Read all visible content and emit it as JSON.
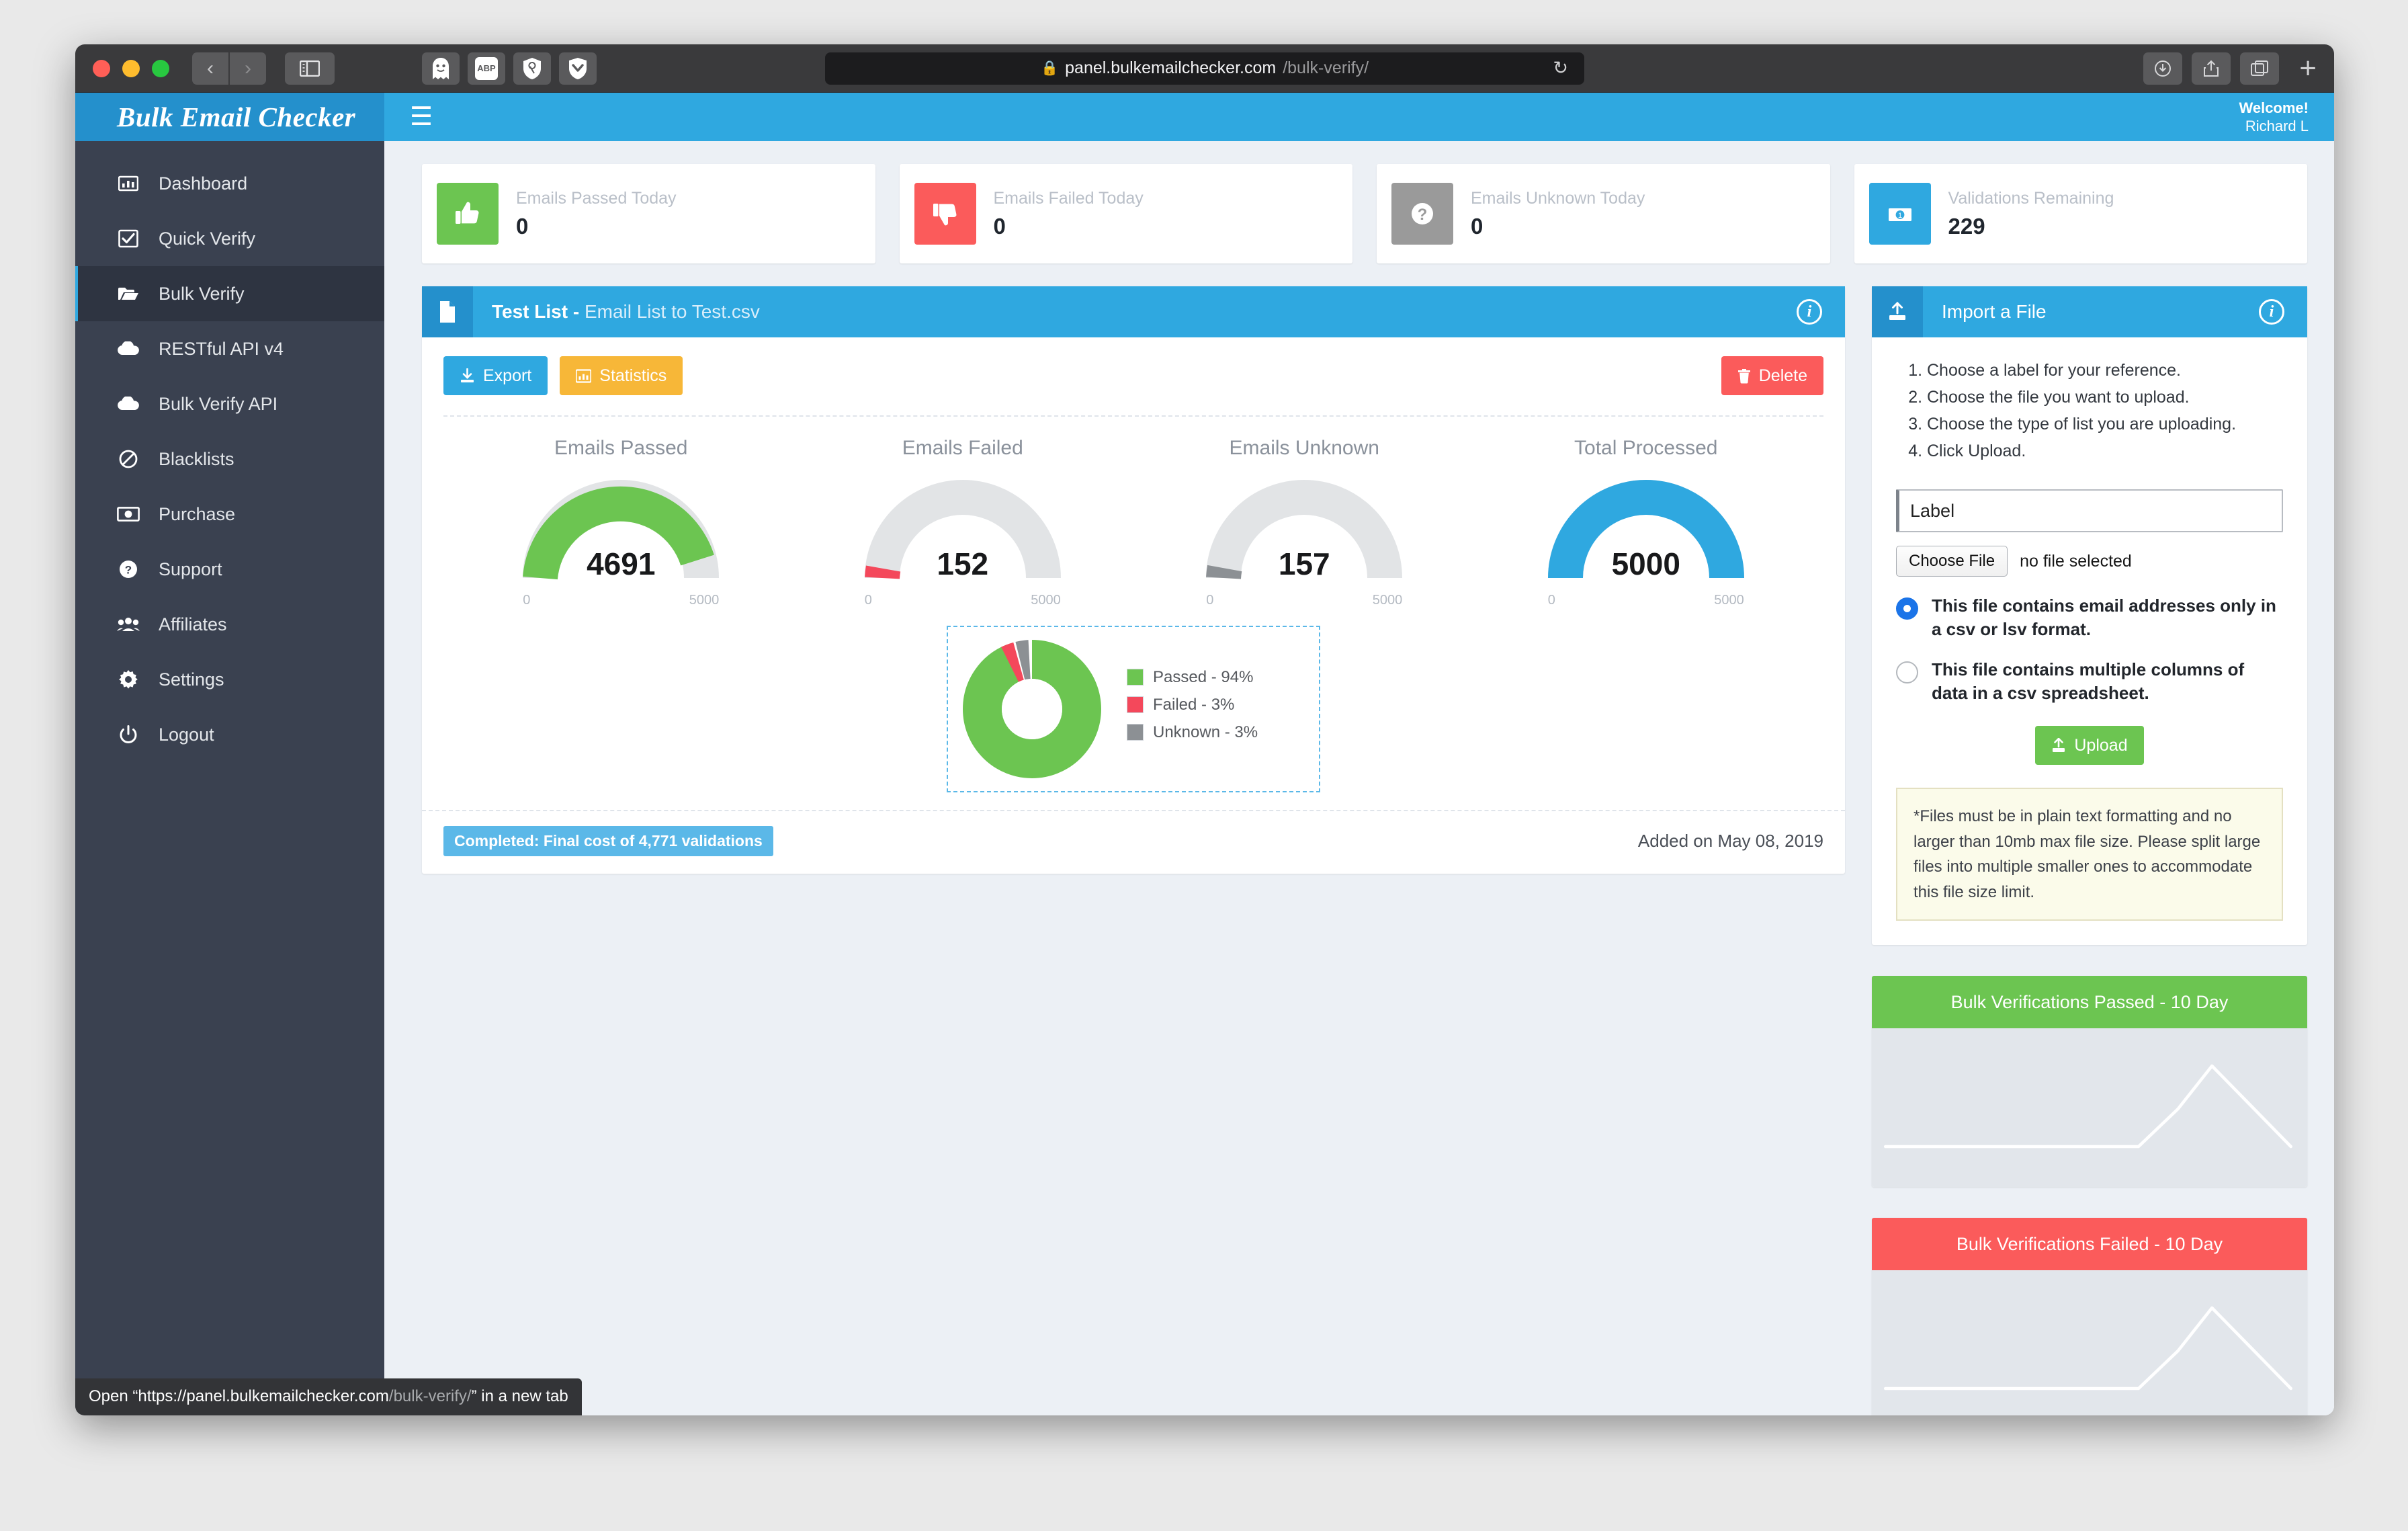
{
  "browser": {
    "url_host": "panel.bulkemailchecker.com",
    "url_path": "/bulk-verify/",
    "lock_icon": "lock-icon",
    "reload_icon": "reload-icon",
    "back_icon": "chevron-left-icon",
    "forward_icon": "chevron-right-icon",
    "sidebar_icon": "sidebar-toggle-icon",
    "newtab_label": "+",
    "extensions": [
      {
        "name": "ghostery-extension-icon",
        "label": ""
      },
      {
        "name": "adblock-plus-extension-icon",
        "label": "ABP"
      },
      {
        "name": "privacy-badger-extension-icon",
        "label": ""
      },
      {
        "name": "pocket-extension-icon",
        "label": ""
      }
    ],
    "status_tooltip_prefix": "Open “https://panel.bulkemailchecker.com",
    "status_tooltip_path": "/bulk-verify/",
    "status_tooltip_suffix": "” in a new tab"
  },
  "topbar": {
    "brand": "Bulk Email Checker",
    "menu_icon": "hamburger-icon",
    "welcome_line1": "Welcome!",
    "welcome_line2": "Richard L"
  },
  "sidebar": {
    "items": [
      {
        "label": "Dashboard",
        "icon": "bar-chart-icon",
        "active": false
      },
      {
        "label": "Quick Verify",
        "icon": "check-square-icon",
        "active": false
      },
      {
        "label": "Bulk Verify",
        "icon": "folder-open-icon",
        "active": true
      },
      {
        "label": "RESTful API v4",
        "icon": "cloud-icon",
        "active": false
      },
      {
        "label": "Bulk Verify API",
        "icon": "cloud-icon",
        "active": false
      },
      {
        "label": "Blacklists",
        "icon": "ban-icon",
        "active": false
      },
      {
        "label": "Purchase",
        "icon": "money-bill-icon",
        "active": false
      },
      {
        "label": "Support",
        "icon": "question-circle-icon",
        "active": false
      },
      {
        "label": "Affiliates",
        "icon": "users-icon",
        "active": false
      },
      {
        "label": "Settings",
        "icon": "gear-icon",
        "active": false
      },
      {
        "label": "Logout",
        "icon": "power-off-icon",
        "active": false
      }
    ]
  },
  "stats": [
    {
      "label": "Emails Passed Today",
      "value": "0",
      "icon": "thumbs-up-icon",
      "color": "#6cc551"
    },
    {
      "label": "Emails Failed Today",
      "value": "0",
      "icon": "thumbs-down-icon",
      "color": "#fb5b5b"
    },
    {
      "label": "Emails Unknown Today",
      "value": "0",
      "icon": "question-mark-icon",
      "color": "#9a9a9a"
    },
    {
      "label": "Validations Remaining",
      "value": "229",
      "icon": "money-bill-icon",
      "color": "#2fa8e0"
    }
  ],
  "list_panel": {
    "head_icon": "file-icon",
    "title": "Test List -",
    "subtitle": "Email List to Test.csv",
    "info_icon": "info-icon",
    "export_label": "Export",
    "export_icon": "download-icon",
    "statistics_label": "Statistics",
    "statistics_icon": "bar-chart-icon",
    "delete_label": "Delete",
    "delete_icon": "trash-icon",
    "completed_badge": "Completed: Final cost of 4,771 validations",
    "added_on": "Added on May 08, 2019"
  },
  "import_panel": {
    "head_icon": "upload-icon",
    "title": "Import a File",
    "info_icon": "info-icon",
    "steps": [
      "Choose a label for your reference.",
      "Choose the file you want to upload.",
      "Choose the type of list you are uploading.",
      "Click Upload."
    ],
    "label_placeholder": "Label",
    "label_value": "",
    "choose_file_label": "Choose File",
    "no_file_label": "no file selected",
    "radio_option_1": "This file contains email addresses only in a csv or lsv format.",
    "radio_option_2": "This file contains multiple columns of data in a csv spreadsheet.",
    "radio_selected": 1,
    "upload_label": "Upload",
    "upload_icon": "upload-icon",
    "note": "*Files must be in plain text formatting and no larger than 10mb max file size. Please split large files into multiple smaller ones to accommodate this file size limit."
  },
  "spark_panels": [
    {
      "title": "Bulk Verifications Passed - 10 Day",
      "color": "#6cc551"
    },
    {
      "title": "Bulk Verifications Failed - 10 Day",
      "color": "#fb5b5b"
    }
  ],
  "chart_data": [
    {
      "type": "gauge",
      "title": "Emails Passed",
      "value": 4691,
      "min": 0,
      "max": 5000,
      "min_label": "0",
      "max_label": "5000",
      "color": "#6cc551",
      "track_color": "#e2e4e6"
    },
    {
      "type": "gauge",
      "title": "Emails Failed",
      "value": 152,
      "min": 0,
      "max": 5000,
      "min_label": "0",
      "max_label": "5000",
      "color": "#f4485b",
      "track_color": "#e2e4e6"
    },
    {
      "type": "gauge",
      "title": "Emails Unknown",
      "value": 157,
      "min": 0,
      "max": 5000,
      "min_label": "0",
      "max_label": "5000",
      "color": "#8c9094",
      "track_color": "#e2e4e6"
    },
    {
      "type": "gauge",
      "title": "Total Processed",
      "value": 5000,
      "min": 0,
      "max": 5000,
      "min_label": "0",
      "max_label": "5000",
      "color": "#2fa8e0",
      "track_color": "#e2e4e6"
    },
    {
      "type": "pie",
      "title": "",
      "categories": [
        "Passed",
        "Failed",
        "Unknown"
      ],
      "values": [
        94,
        3,
        3
      ],
      "legend": [
        "Passed - 94%",
        "Failed - 3%",
        "Unknown - 3%"
      ],
      "colors": [
        "#6cc551",
        "#f4485b",
        "#8c9094"
      ],
      "legend_position": "right",
      "donut": true
    },
    {
      "type": "line",
      "title": "Bulk Verifications Passed - 10 Day",
      "x": [
        1,
        2,
        3,
        4,
        5,
        6,
        7,
        8,
        9,
        10
      ],
      "values": [
        0,
        0,
        0,
        0,
        0,
        0,
        0,
        0,
        4691,
        0
      ],
      "line_color": "#ffffff",
      "grid": false
    },
    {
      "type": "line",
      "title": "Bulk Verifications Failed - 10 Day",
      "x": [
        1,
        2,
        3,
        4,
        5,
        6,
        7,
        8,
        9,
        10
      ],
      "values": [
        0,
        0,
        0,
        0,
        0,
        0,
        0,
        0,
        152,
        0
      ],
      "line_color": "#ffffff",
      "grid": false
    }
  ]
}
